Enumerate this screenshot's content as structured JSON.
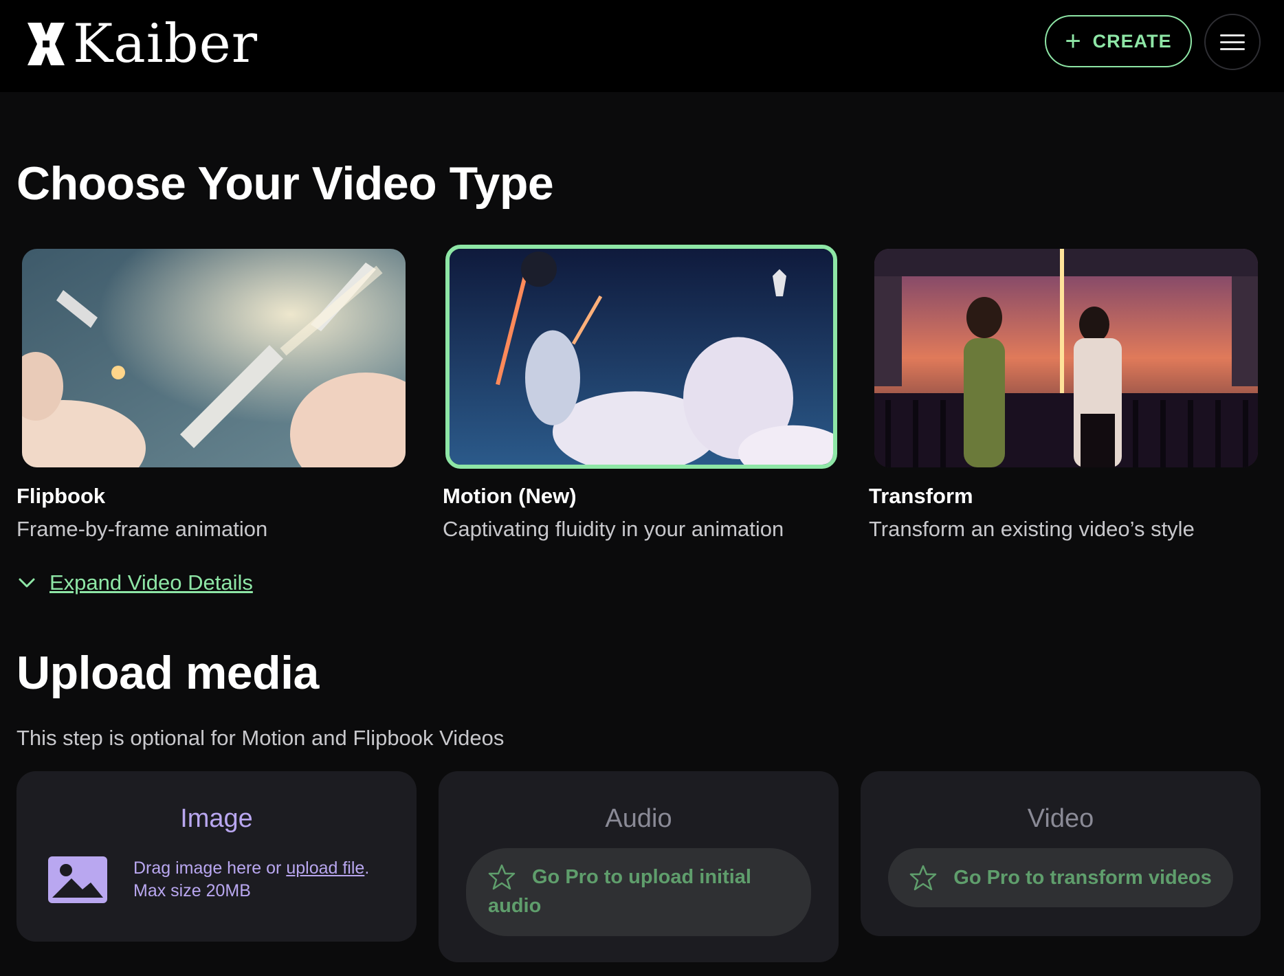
{
  "header": {
    "logo_text": "Kaiber",
    "create_label": "CREATE"
  },
  "video_type": {
    "heading": "Choose Your Video Type",
    "options": [
      {
        "title": "Flipbook",
        "description": "Frame-by-frame animation",
        "selected": false
      },
      {
        "title": "Motion (New)",
        "description": "Captivating fluidity in your animation",
        "selected": true
      },
      {
        "title": "Transform",
        "description": "Transform an existing video’s style",
        "selected": false
      }
    ],
    "expand_label": "Expand Video Details"
  },
  "upload": {
    "heading": "Upload media",
    "subtitle": "This step is optional for Motion and Flipbook Videos",
    "cards": [
      {
        "title": "Image",
        "drag_text": "Drag image here or ",
        "link_text": "upload file",
        "after_link": ".",
        "max_size": "Max size 20MB"
      },
      {
        "title": "Audio",
        "pro_label_line1": "Go Pro to upload initial",
        "pro_label_line2": "audio"
      },
      {
        "title": "Video",
        "pro_label": "Go Pro to transform videos"
      }
    ]
  },
  "colors": {
    "accent_green": "#8ee6a6",
    "accent_purple": "#b9a7f0",
    "background": "#0b0b0c",
    "card": "#1c1c21"
  },
  "icons": [
    "kaiber-logo-icon",
    "plus-icon",
    "hamburger-menu-icon",
    "chevron-down-icon",
    "image-icon",
    "star-icon"
  ]
}
